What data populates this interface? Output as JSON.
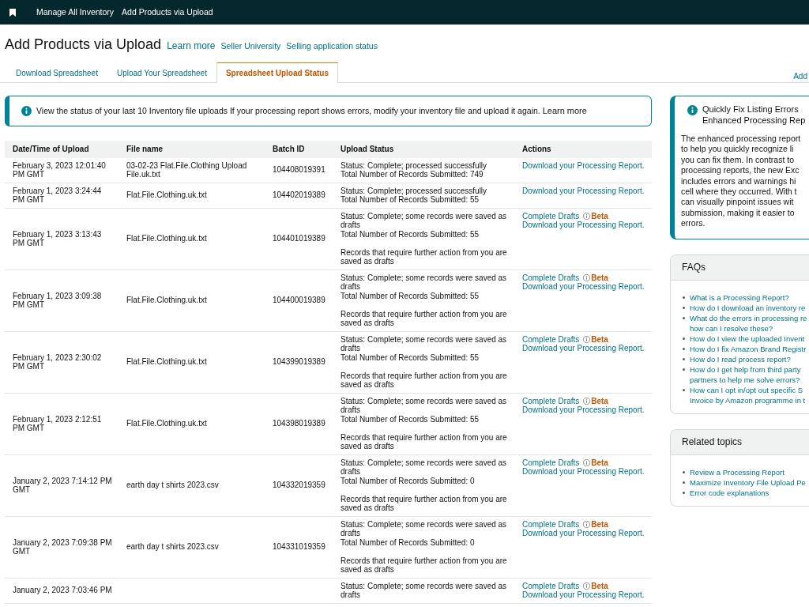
{
  "top_nav": {
    "items": [
      {
        "label": "Manage All Inventory"
      },
      {
        "label": "Add Products via Upload"
      }
    ]
  },
  "header": {
    "title": "Add Products via Upload",
    "learn_more": "Learn more",
    "links": [
      "Seller University",
      "Selling application status"
    ]
  },
  "tabs": [
    {
      "label": "Download Spreadsheet",
      "selected": false
    },
    {
      "label": "Upload Your Spreadsheet",
      "selected": false
    },
    {
      "label": "Spreadsheet Upload Status",
      "selected": true
    }
  ],
  "tabs_right_link": "Add",
  "alert": {
    "text": "View the status of your last 10 Inventory file uploads If your processing report shows errors, modify your inventory file and upload it again.",
    "link": "Learn more"
  },
  "table": {
    "columns": [
      "Date/Time of Upload",
      "File name",
      "Batch ID",
      "Upload Status",
      "Actions"
    ],
    "rows": [
      {
        "date": "February 3, 2023 12:01:40 PM GMT",
        "file_name": "03-02-23 Flat.File.Clothing Upload File.uk.txt",
        "batch_id": "104408019391",
        "status": "Status: Complete; processed successfully",
        "records_submitted": "Total Number of Records Submitted: 749",
        "actions": [
          {
            "label": "Download your Processing Report."
          }
        ]
      },
      {
        "date": "February 1, 2023 3:24:44 PM GMT",
        "file_name": "Flat.File.Clothing.uk.txt",
        "batch_id": "104402019389",
        "status": "Status: Complete; processed successfully",
        "records_submitted": "Total Number of Records Submitted: 55",
        "actions": [
          {
            "label": "Download your Processing Report."
          }
        ]
      },
      {
        "date": "February 1, 2023 3:13:43 PM GMT",
        "file_name": "Flat.File.Clothing.uk.txt",
        "batch_id": "104401019389",
        "status": "Status: Complete; some records were saved as drafts",
        "records_submitted": "Total Number of Records Submitted: 55",
        "note": "Records that require further action from you are saved as drafts",
        "actions": [
          {
            "label": "Complete Drafts",
            "badge": "Beta"
          },
          {
            "label": "Download your Processing Report."
          }
        ]
      },
      {
        "date": "February 1, 2023 3:09:38 PM GMT",
        "file_name": "Flat.File.Clothing.uk.txt",
        "batch_id": "104400019389",
        "status": "Status: Complete; some records were saved as drafts",
        "records_submitted": "Total Number of Records Submitted: 55",
        "note": "Records that require further action from you are saved as drafts",
        "actions": [
          {
            "label": "Complete Drafts",
            "badge": "Beta"
          },
          {
            "label": "Download your Processing Report."
          }
        ]
      },
      {
        "date": "February 1, 2023 2:30:02 PM GMT",
        "file_name": "Flat.File.Clothing.uk.txt",
        "batch_id": "104399019389",
        "status": "Status: Complete; some records were saved as drafts",
        "records_submitted": "Total Number of Records Submitted: 55",
        "note": "Records that require further action from you are saved as drafts",
        "actions": [
          {
            "label": "Complete Drafts",
            "badge": "Beta"
          },
          {
            "label": "Download your Processing Report."
          }
        ]
      },
      {
        "date": "February 1, 2023 2:12:51 PM GMT",
        "file_name": "Flat.File.Clothing.uk.txt",
        "batch_id": "104398019389",
        "status": "Status: Complete; some records were saved as drafts",
        "records_submitted": "Total Number of Records Submitted: 55",
        "note": "Records that require further action from you are saved as drafts",
        "actions": [
          {
            "label": "Complete Drafts",
            "badge": "Beta"
          },
          {
            "label": "Download your Processing Report."
          }
        ]
      },
      {
        "date": "January 2, 2023 7:14:12 PM GMT",
        "file_name": "earth day t shirts 2023.csv",
        "batch_id": "104332019359",
        "status": "Status: Complete; some records were saved as drafts",
        "records_submitted": "Total Number of Records Submitted: 0",
        "note": "Records that require further action from you are saved as drafts",
        "actions": [
          {
            "label": "Complete Drafts",
            "badge": "Beta"
          },
          {
            "label": "Download your Processing Report."
          }
        ]
      },
      {
        "date": "January 2, 2023 7:09:38 PM GMT",
        "file_name": "earth day t shirts 2023.csv",
        "batch_id": "104331019359",
        "status": "Status: Complete; some records were saved as drafts",
        "records_submitted": "Total Number of Records Submitted: 0",
        "note": "Records that require further action from you are saved as drafts",
        "actions": [
          {
            "label": "Complete Drafts",
            "badge": "Beta"
          },
          {
            "label": "Download your Processing Report."
          }
        ]
      },
      {
        "date": "January 2, 2023 7:03:46 PM",
        "status": "Status: Complete; some records were saved as drafts",
        "actions": [
          {
            "label": "Complete Drafts",
            "badge": "Beta"
          },
          {
            "label": "Download your Processing Report."
          }
        ]
      }
    ]
  },
  "side_panel": {
    "notice": {
      "title_lines": [
        "Quickly Fix Listing Errors",
        "Enhanced Processing Rep"
      ],
      "body_lines": [
        "The enhanced processing report",
        "to help you quickly recognize li",
        "you can fix them. In contrast to",
        "processing reports, the new Exc",
        "includes errors and warnings hi",
        "cell where they occurred. With t",
        "can visually pinpoint issues wit",
        "submission, making it easier to",
        "errors."
      ]
    },
    "faqs": {
      "title": "FAQs",
      "items": [
        {
          "lines": [
            "What is a Processing Report?"
          ]
        },
        {
          "lines": [
            "How do I download an inventory re"
          ]
        },
        {
          "lines": [
            "What do the errors in processing re",
            "how can I resolve these?"
          ]
        },
        {
          "lines": [
            "How do I view the uploaded Invent"
          ]
        },
        {
          "lines": [
            "How do I fix Amazon Brand Registr"
          ]
        },
        {
          "lines": [
            "How do I read process report?"
          ]
        },
        {
          "lines": [
            "How do I get help from third party",
            "partners to help me solve errors?"
          ]
        },
        {
          "lines": [
            "How can I opt in/opt out specific S",
            "Invoice by Amazon programme in t"
          ]
        }
      ]
    },
    "related_topics": {
      "title": "Related topics",
      "items": [
        {
          "lines": [
            "Review a Processing Report"
          ]
        },
        {
          "lines": [
            "Maximize Inventory File Upload Pe"
          ]
        },
        {
          "lines": [
            "Error code explanations"
          ]
        }
      ]
    }
  }
}
